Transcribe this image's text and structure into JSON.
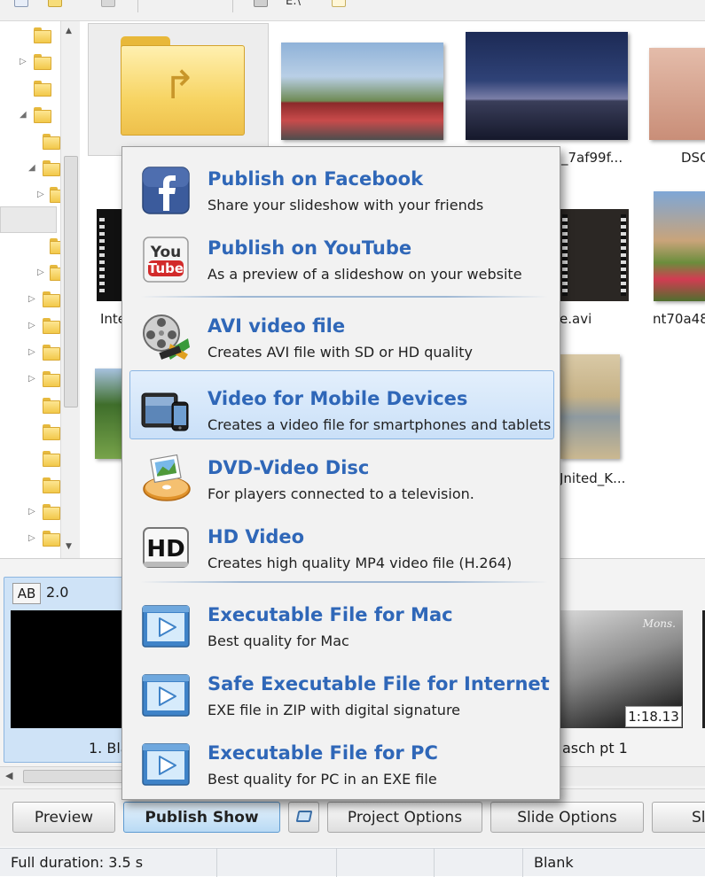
{
  "toolbar": {
    "drive_label": "E:\\"
  },
  "content": {
    "captions": {
      "c1": "_7af99f...",
      "c2": "DSC",
      "c3": "Inte",
      "c4": "e.avi",
      "c5": "nt70a48",
      "c6": "Jnited_K..."
    }
  },
  "timeline": {
    "slide1_badge": "AB",
    "slide1_duration": "2.0",
    "slide1_name": "1. Bla",
    "slide2_watermark": "Mons.",
    "slide2_time": "1:18.13",
    "slide2_name": "asch pt 1"
  },
  "publish_menu": {
    "items": [
      {
        "title": "Publish on Facebook",
        "desc": "Share your slideshow with your friends",
        "icon": "facebook-icon"
      },
      {
        "title": "Publish on YouTube",
        "desc": "As a preview of a slideshow on your website",
        "icon": "youtube-icon"
      },
      {
        "title": "AVI video file",
        "desc": "Creates AVI file with SD or HD quality",
        "icon": "film-reel-icon"
      },
      {
        "title": "Video for Mobile Devices",
        "desc": "Creates a video file for smartphones and tablets",
        "icon": "mobile-devices-icon"
      },
      {
        "title": "DVD-Video Disc",
        "desc": "For players connected to a television.",
        "icon": "dvd-disc-icon"
      },
      {
        "title": "HD Video",
        "desc": "Creates high quality MP4 video file (H.264)",
        "icon": "hd-icon"
      },
      {
        "title": "Executable File for Mac",
        "desc": "Best quality for Mac",
        "icon": "executable-play-icon"
      },
      {
        "title": "Safe Executable File for Internet",
        "desc": "EXE file in ZIP with digital signature",
        "icon": "executable-play-icon"
      },
      {
        "title": "Executable File for PC",
        "desc": "Best quality for PC in an EXE file",
        "icon": "executable-play-icon"
      }
    ],
    "highlighted_index": 3
  },
  "buttons": {
    "preview": "Preview",
    "publish_show": "Publish Show",
    "project_options": "Project Options",
    "slide_options": "Slide Options",
    "cut_off": "Sl"
  },
  "status": {
    "full_duration": "Full duration: 3.5 s",
    "transition": "Blank"
  },
  "colors": {
    "menu_title": "#2f67b8",
    "highlight": "#cae0f8",
    "primary_button": "#b9daf4"
  }
}
